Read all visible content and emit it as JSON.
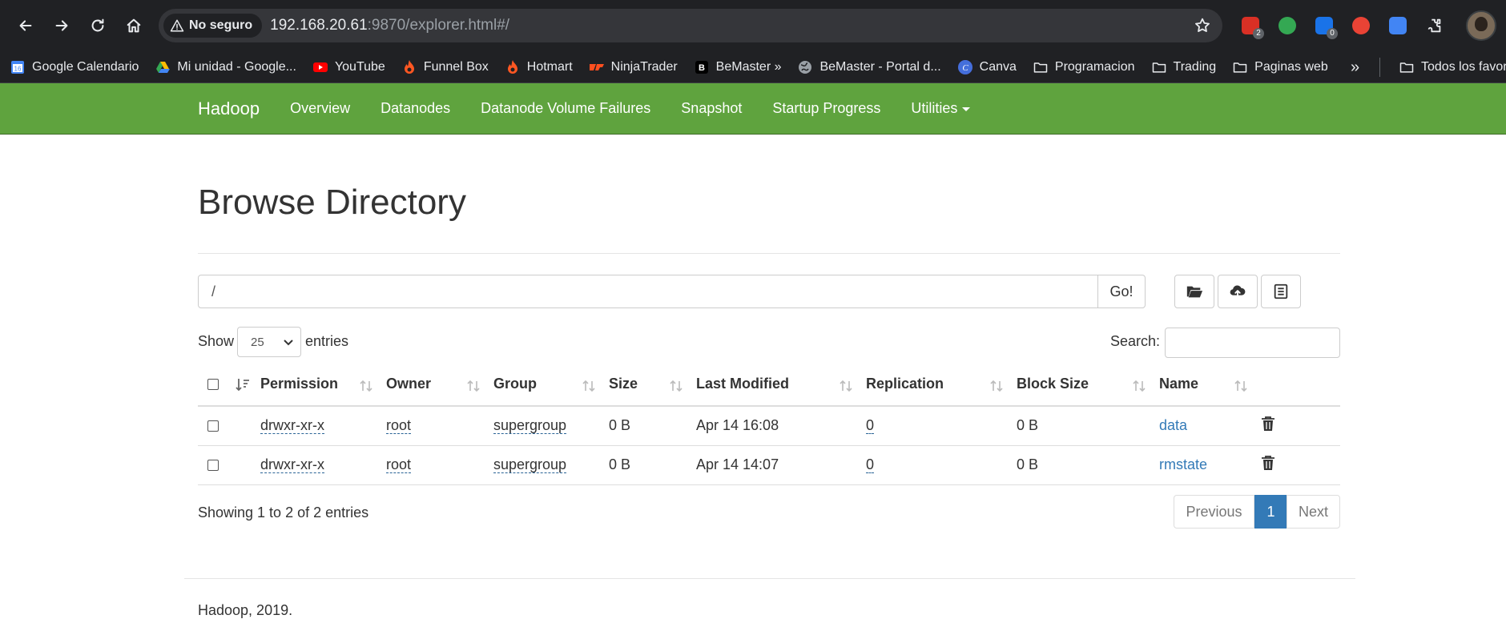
{
  "browser": {
    "security_label": "No seguro",
    "url_host": "192.168.20.61",
    "url_rest": ":9870/explorer.html#/",
    "extensions": [
      {
        "name": "todoist-ext-icon",
        "color": "#d93025",
        "badge": "2"
      },
      {
        "name": "robot-ext-icon",
        "color": "#34a853",
        "badge": ""
      },
      {
        "name": "pieces-ext-icon",
        "color": "#1a73e8",
        "badge": "0"
      },
      {
        "name": "stop-ext-icon",
        "color": "#ea4335",
        "badge": ""
      },
      {
        "name": "translate-ext-icon",
        "color": "#4285f4",
        "badge": ""
      }
    ]
  },
  "bookmarks": {
    "items": [
      {
        "label": "Google Calendario",
        "icon": "calendar-icon"
      },
      {
        "label": "Mi unidad - Google...",
        "icon": "drive-icon"
      },
      {
        "label": "YouTube",
        "icon": "youtube-icon"
      },
      {
        "label": "Funnel Box",
        "icon": "flame-icon"
      },
      {
        "label": "Hotmart",
        "icon": "flame-icon"
      },
      {
        "label": "NinjaTrader",
        "icon": "ninjatrader-icon"
      },
      {
        "label": "BeMaster »",
        "icon": "bemaster-icon"
      },
      {
        "label": "BeMaster - Portal d...",
        "icon": "globe-icon"
      },
      {
        "label": "Canva",
        "icon": "canva-icon"
      },
      {
        "label": "Programacion",
        "icon": "folder-icon"
      },
      {
        "label": "Trading",
        "icon": "folder-icon"
      },
      {
        "label": "Paginas web",
        "icon": "folder-icon"
      }
    ],
    "more": "»",
    "all": "Todos los favor"
  },
  "navbar": {
    "brand": "Hadoop",
    "items": [
      "Overview",
      "Datanodes",
      "Datanode Volume Failures",
      "Snapshot",
      "Startup Progress",
      "Utilities"
    ],
    "color": "#5fa33e"
  },
  "page": {
    "title": "Browse Directory",
    "path_value": "/",
    "go_label": "Go!",
    "show_label": "Show",
    "entries_value": "25",
    "entries_label": "entries",
    "search_label": "Search:",
    "search_value": ""
  },
  "table": {
    "headers": [
      "Permission",
      "Owner",
      "Group",
      "Size",
      "Last Modified",
      "Replication",
      "Block Size",
      "Name"
    ],
    "rows": [
      {
        "permission": "drwxr-xr-x",
        "owner": "root",
        "group": "supergroup",
        "size": "0 B",
        "modified": "Apr 14 16:08",
        "replication": "0",
        "block_size": "0 B",
        "name": "data"
      },
      {
        "permission": "drwxr-xr-x",
        "owner": "root",
        "group": "supergroup",
        "size": "0 B",
        "modified": "Apr 14 14:07",
        "replication": "0",
        "block_size": "0 B",
        "name": "rmstate"
      }
    ]
  },
  "pagination": {
    "showing": "Showing 1 to 2 of 2 entries",
    "previous": "Previous",
    "current": "1",
    "next": "Next"
  },
  "footer": "Hadoop, 2019."
}
